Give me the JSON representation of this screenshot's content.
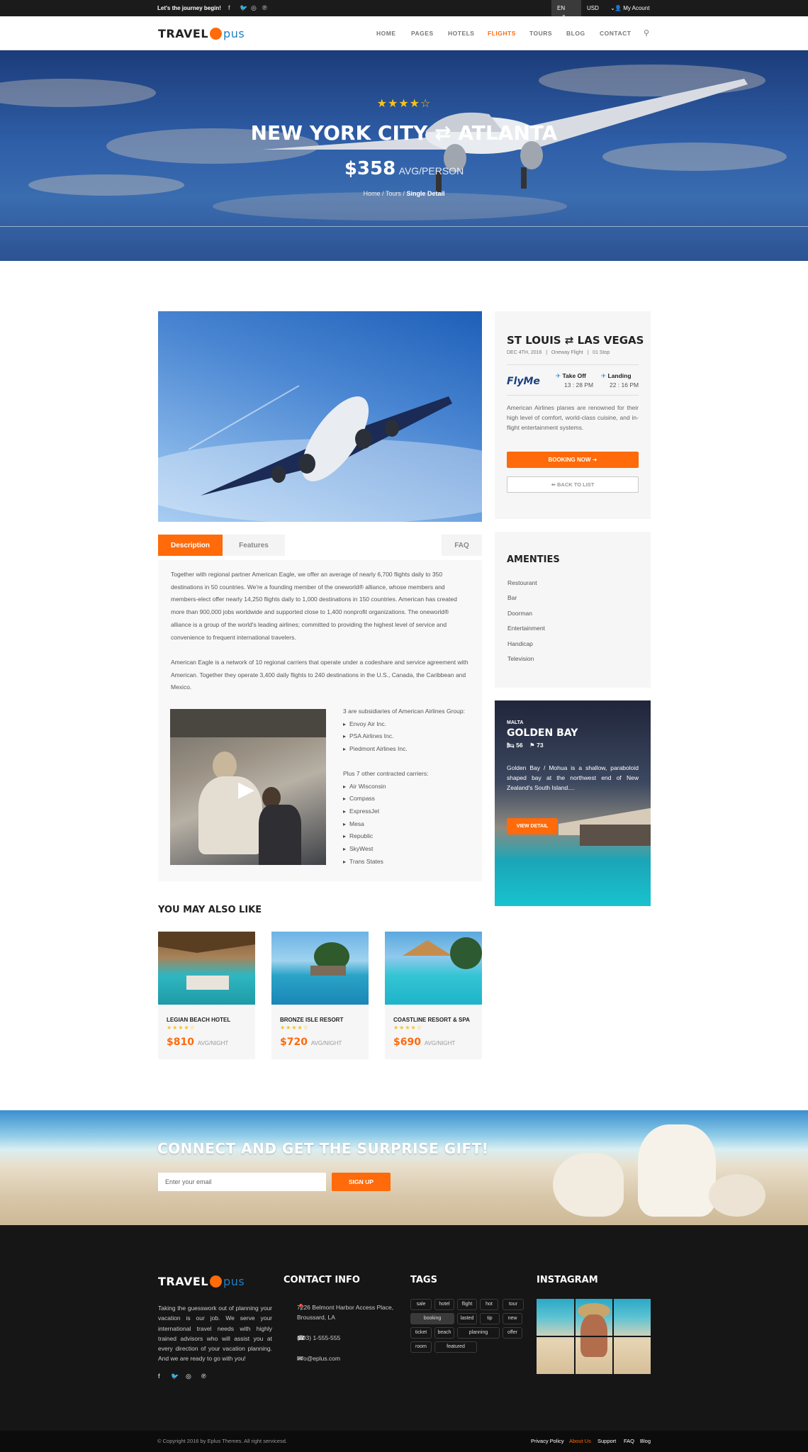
{
  "topbar": {
    "tagline": "Let's the journey begin!",
    "language": "EN",
    "currency": "USD",
    "account": "My Acount"
  },
  "logo": {
    "part1": "TRAVEL",
    "part2": "pus"
  },
  "nav": [
    "HOME",
    "PAGES",
    "HOTELS",
    "FLIGHTS",
    "TOURS",
    "BLOG",
    "CONTACT"
  ],
  "hero": {
    "stars": "★★★★☆",
    "from": "NEW YORK CITY",
    "arrow": "⇄",
    "to": "ATLANTA",
    "price": "$358",
    "price_unit": "AVG/PERSON",
    "breadcrumb": [
      "Home",
      "Tours",
      "Single Detail"
    ]
  },
  "flight": {
    "from": "ST LOUIS",
    "to": "LAS VEGAS",
    "date": "DEC 4TH, 2016",
    "type": "Oneway Flight",
    "stops": "01 Stop",
    "airline": "FlyMe",
    "takeoff_label": "Take Off",
    "takeoff_time": "13 : 28 PM",
    "landing_label": "Landing",
    "landing_time": "22 : 16 PM",
    "about": "American Airlines planes are renowned for their high level of comfort, world-class cuisine, and in-flight entertainment systems.",
    "book_label": "BOOKING NOW",
    "back_label": "BACK TO LIST"
  },
  "tabs": [
    "Description",
    "Features",
    "FAQ"
  ],
  "description": {
    "p1": "Together with regional partner American Eagle, we offer an average of nearly 6,700 flights daily to 350 destinations in 50 countries. We're a founding member of the oneworld® alliance, whose members and members-elect offer nearly 14,250 flights daily to 1,000 destinations in 150 countries. American has created more than 900,000 jobs worldwide and supported close to 1,400 nonprofit organizations. The oneworld® alliance is a group of the world's leading airlines; committed to providing the highest level of service and convenience to frequent international travelers.",
    "p2": "American Eagle is a network of 10 regional carriers that operate under a codeshare and service agreement with American. Together they operate 3,400 daily flights to 240 destinations in the U.S., Canada, the Caribbean and Mexico.",
    "sub_heading": "3 are subsidiaries of American Airlines Group:",
    "subsidiaries": [
      "Envoy Air Inc.",
      "PSA Airlines Inc.",
      "Piedmont Airlines Inc."
    ],
    "carriers_heading": "Plus 7 other contracted carriers:",
    "carriers": [
      "Air Wisconsin",
      "Compass",
      "ExpressJet",
      "Mesa",
      "Republic",
      "SkyWest",
      "Trans States"
    ]
  },
  "amenities": {
    "title": "AMENTIES",
    "items": [
      "Restourant",
      "Bar",
      "Doorman",
      "Entertainment",
      "Handicap",
      "Television"
    ]
  },
  "promo": {
    "country": "MALTA",
    "title": "GOLDEN BAY",
    "beds": "56",
    "flags": "73",
    "text": "Golden Bay / Mohua is a shallow, paraboloid shaped bay at the northwest end of New Zealand's South Island....",
    "button": "VIEW DETAIL"
  },
  "related": {
    "title": "YOU MAY ALSO LIKE",
    "items": [
      {
        "name": "LEGIAN BEACH HOTEL",
        "stars": "★★★★☆",
        "price": "$810",
        "unit": "AVG/NIGHT"
      },
      {
        "name": "BRONZE ISLE RESORT",
        "stars": "★★★★☆",
        "price": "$720",
        "unit": "AVG/NIGHT"
      },
      {
        "name": "COASTLINE RESORT & SPA",
        "stars": "★★★★☆",
        "price": "$690",
        "unit": "AVG/NIGHT"
      }
    ]
  },
  "newsletter": {
    "title": "CONNECT AND GET THE SURPRISE GIFT!",
    "placeholder": "Enter your email",
    "button": "SIGN UP"
  },
  "footer": {
    "about": "Taking the guesswork out of planning your vacation is our job. We serve your international travel needs with highly trained advisors who will assist you at every direction of your vacation planning. And we are ready to go with you!",
    "contact_title": "CONTACT INFO",
    "address": "7226 Belmont Harbor Access Place, Broussard, LA",
    "phone": "(+93) 1-555-555",
    "email": "info@eplus.com",
    "tags_title": "TAGS",
    "tags": [
      "sale",
      "hotel",
      "flight",
      "hot",
      "tour",
      "booking",
      "lasted",
      "tip",
      "new",
      "ticket",
      "beach",
      "planning",
      "offer",
      "room",
      "featured"
    ],
    "instagram_title": "INSTAGRAM",
    "copyright": "© Copyright 2016 by Eplus Themes. All right servicesd.",
    "links": [
      "Privacy Policy",
      "About Us",
      "Support",
      "FAQ",
      "Blog"
    ]
  },
  "colors": {
    "accent": "#ff6a0a",
    "dark": "#161616",
    "brand_blue": "#1d7fc4"
  }
}
